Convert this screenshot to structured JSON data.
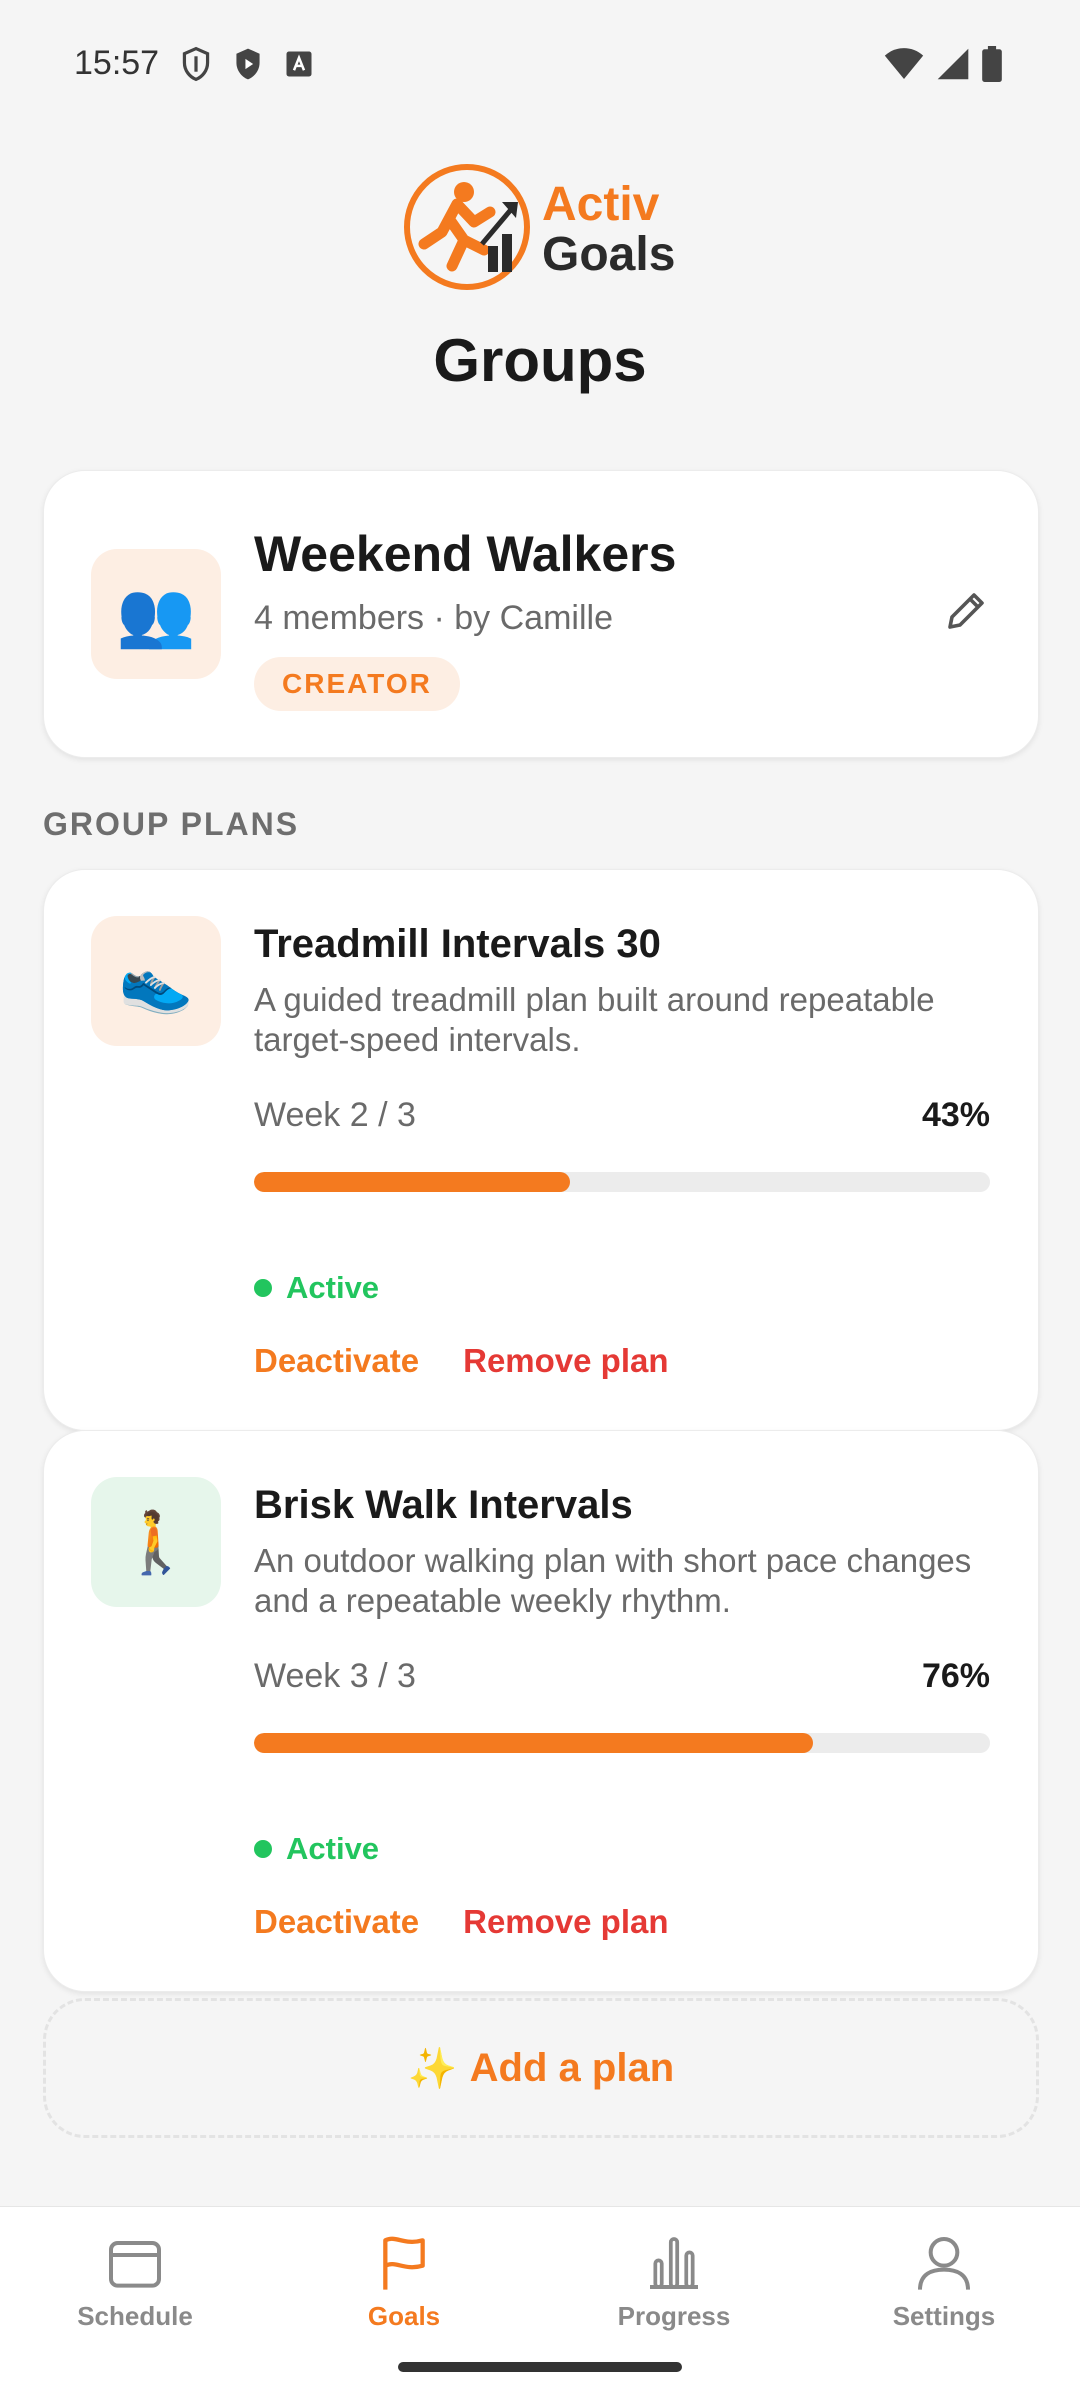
{
  "status_bar": {
    "time": "15:57",
    "left_icons": [
      "shield-icon",
      "play-protect-icon",
      "keyboard-a-icon"
    ],
    "right_icons": [
      "wifi-icon",
      "signal-icon",
      "battery-icon"
    ]
  },
  "logo": {
    "line1": "Activ",
    "line2": "Goals"
  },
  "page": {
    "title": "Groups"
  },
  "group": {
    "name": "Weekend Walkers",
    "meta": "4 members · by Camille",
    "badge": "CREATOR",
    "avatar_emoji": "👥"
  },
  "section": {
    "label": "GROUP PLANS"
  },
  "plans": [
    {
      "title": "Treadmill Intervals 30",
      "description": "A guided treadmill plan built around repeatable target-speed intervals.",
      "week": "Week 2 / 3",
      "percent_label": "43%",
      "progress": 0.43,
      "status": "Active",
      "deactivate_label": "Deactivate",
      "remove_label": "Remove plan",
      "icon_emoji": "👟"
    },
    {
      "title": "Brisk Walk Intervals",
      "description": "An outdoor walking plan with short pace changes and a repeatable weekly rhythm.",
      "week": "Week 3 / 3",
      "percent_label": "76%",
      "progress": 0.76,
      "status": "Active",
      "deactivate_label": "Deactivate",
      "remove_label": "Remove plan",
      "icon_emoji": "🚶"
    }
  ],
  "add_plan": {
    "icon_emoji": "✨",
    "label": "Add a plan"
  },
  "nav": {
    "items": [
      {
        "label": "Schedule",
        "icon": "calendar-icon"
      },
      {
        "label": "Goals",
        "icon": "flag-icon",
        "active": true
      },
      {
        "label": "Progress",
        "icon": "bar-chart-icon"
      },
      {
        "label": "Settings",
        "icon": "person-icon"
      }
    ]
  },
  "colors": {
    "accent": "#f47a1f",
    "danger": "#e53935",
    "success": "#22c55e"
  }
}
